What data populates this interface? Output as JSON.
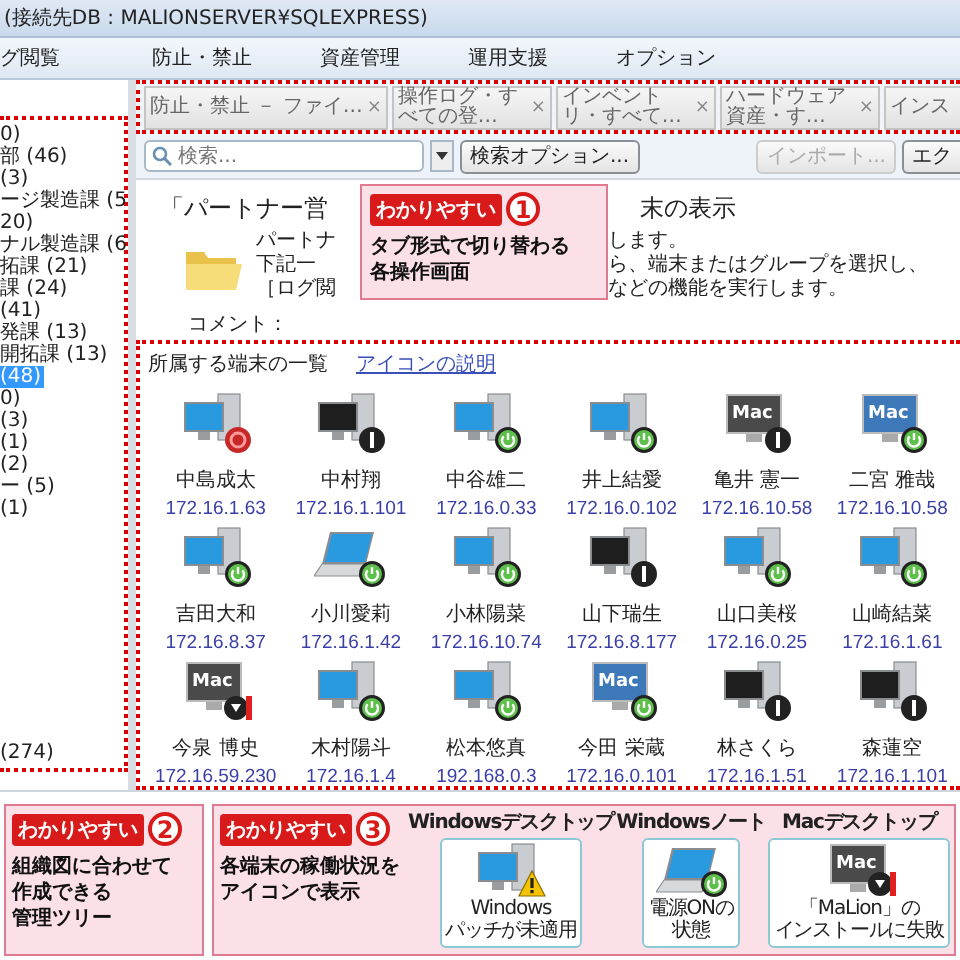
{
  "window": {
    "title": "(接続先DB : MALIONSERVER¥SQLEXPRESS)"
  },
  "menu": [
    {
      "label": "グ閲覧"
    },
    {
      "label": "防止・禁止"
    },
    {
      "label": "資産管理"
    },
    {
      "label": "運用支援"
    },
    {
      "label": "オプション"
    }
  ],
  "tabs": [
    {
      "label": "防止・禁止 － ファイ…",
      "close": "×",
      "selected": false
    },
    {
      "label": "操作ログ・すべての登…",
      "close": "×",
      "selected": false
    },
    {
      "label": "インベントリ・すべて…",
      "close": "×",
      "selected": false
    },
    {
      "label": "ハードウェア資産・す…",
      "close": "×",
      "selected": false
    },
    {
      "label": "インス",
      "selected": false
    }
  ],
  "tree": {
    "items": [
      {
        "label": "0)",
        "selected": false
      },
      {
        "label": "部 (46)",
        "selected": false
      },
      {
        "label": "(3)",
        "selected": false
      },
      {
        "label": "ージ製造課 (5",
        "selected": false
      },
      {
        "label": "20)",
        "selected": false
      },
      {
        "label": "ナル製造課 (6",
        "selected": false
      },
      {
        "label": "拓課 (21)",
        "selected": false
      },
      {
        "label": "課 (24)",
        "selected": false
      },
      {
        "label": "(41)",
        "selected": false
      },
      {
        "label": "発課 (13)",
        "selected": false
      },
      {
        "label": "開拓課 (13)",
        "selected": false
      },
      {
        "label": "(48)",
        "selected": true
      },
      {
        "label": "0)",
        "selected": false
      },
      {
        "label": "(3)",
        "selected": false
      },
      {
        "label": "(1)",
        "selected": false
      },
      {
        "label": "(2)",
        "selected": false
      },
      {
        "label": "ー (5)",
        "selected": false
      },
      {
        "label": "(1)",
        "selected": false
      }
    ],
    "total": "(274)"
  },
  "toolbar": {
    "search": {
      "placeholder": "検索..."
    },
    "options_button": "検索オプション...",
    "import_button": {
      "label": "インポート...",
      "disabled": true
    },
    "export_button": {
      "label": "エク",
      "disabled": false
    }
  },
  "group": {
    "heading_start": "「パートナー営",
    "heading_end": "末の表示",
    "description": [
      {
        "start": "パートナ",
        "end": "します。"
      },
      {
        "start": "下記一",
        "end": "ら、端末またはグループを選択し、"
      },
      {
        "start": "［ログ閲",
        "end": "などの機能を実行します。"
      }
    ],
    "comment_label": "コメント："
  },
  "devices": {
    "title": "所属する端末の一覧",
    "help_link": "アイコンの説明",
    "items": [
      {
        "name": "中島成太",
        "ip": "172.16.1.63",
        "kind": "desktop-error"
      },
      {
        "name": "中村翔",
        "ip": "172.16.1.101",
        "kind": "desktop-off"
      },
      {
        "name": "中谷雄二",
        "ip": "172.16.0.33",
        "kind": "desktop-on"
      },
      {
        "name": "井上結愛",
        "ip": "172.16.0.102",
        "kind": "desktop-on"
      },
      {
        "name": "亀井 憲一",
        "ip": "172.16.10.58",
        "kind": "mac-off",
        "screen_label": "Mac"
      },
      {
        "name": "二宮 雅哉",
        "ip": "172.16.10.58",
        "kind": "mac-on",
        "screen_label": "Mac"
      },
      {
        "name": "吉田大和",
        "ip": "172.16.8.37",
        "kind": "desktop-on"
      },
      {
        "name": "小川愛莉",
        "ip": "172.16.1.42",
        "kind": "laptop-on"
      },
      {
        "name": "小林陽菜",
        "ip": "172.16.10.74",
        "kind": "desktop-on"
      },
      {
        "name": "山下瑞生",
        "ip": "172.16.8.177",
        "kind": "desktop-off"
      },
      {
        "name": "山口美桜",
        "ip": "172.16.0.25",
        "kind": "desktop-on"
      },
      {
        "name": "山崎結菜",
        "ip": "172.16.1.61",
        "kind": "desktop-on"
      },
      {
        "name": "今泉 博史",
        "ip": "172.16.59.230",
        "kind": "mac-failed",
        "screen_label": "Mac"
      },
      {
        "name": "木村陽斗",
        "ip": "172.16.1.4",
        "kind": "desktop-on"
      },
      {
        "name": "松本悠真",
        "ip": "192.168.0.3",
        "kind": "desktop-on"
      },
      {
        "name": "今田 栄蔵",
        "ip": "172.16.0.101",
        "kind": "mac-on",
        "screen_label": "Mac"
      },
      {
        "name": "林さくら",
        "ip": "172.16.1.51",
        "kind": "desktop-off"
      },
      {
        "name": "森蓮空",
        "ip": "172.16.1.101",
        "kind": "desktop-off"
      }
    ]
  },
  "callout_tabs": {
    "label": "わかりやすい",
    "number": "1",
    "lines": [
      "タブ形式で切り替わる",
      "各操作画面"
    ]
  },
  "callout_tree": {
    "label": "わかりやすい",
    "number": "2",
    "lines": [
      "組織図に合わせて",
      "作成できる",
      "管理ツリー"
    ]
  },
  "callout_icons": {
    "label": "わかりやすい",
    "number": "3",
    "lines": [
      "各端末の稼働状況を",
      "アイコンで表示"
    ],
    "legend": [
      {
        "title": "Windowsデスクトップ",
        "kind": "desktop-warning",
        "caption": [
          "Windows",
          "パッチが未適用"
        ]
      },
      {
        "title": "Windowsノート",
        "kind": "laptop-on",
        "caption": [
          "電源ONの",
          "状態"
        ]
      },
      {
        "title": "Macデスクトップ",
        "kind": "mac-failed",
        "screen_label": "Mac",
        "caption": [
          "「MaLion」の",
          "インストールに失敗"
        ]
      }
    ]
  }
}
